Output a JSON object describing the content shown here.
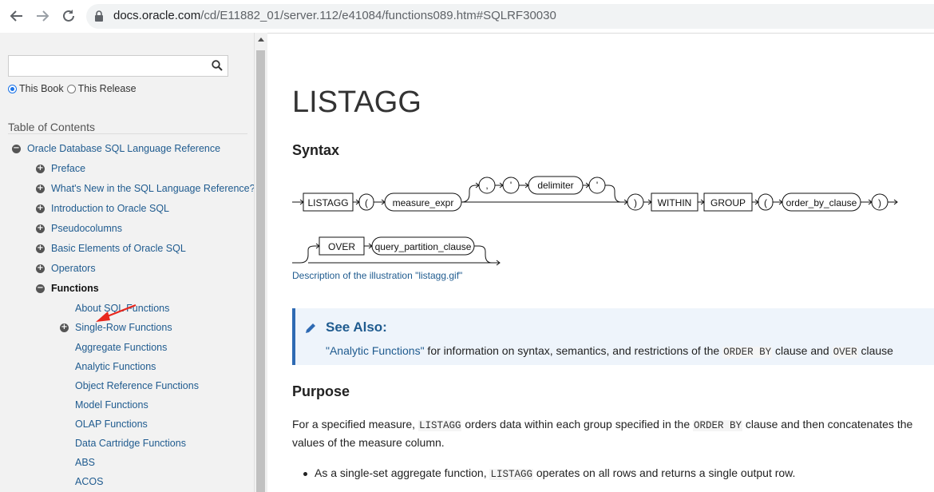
{
  "browser": {
    "url_host": "docs.oracle.com",
    "url_path": "/cd/E11882_01/server.112/e41084/functions089.htm#SQLRF30030"
  },
  "sidebar": {
    "search_placeholder": "",
    "radio_this_book": "This Book",
    "radio_this_release": "This Release",
    "toc_title": "Table of Contents",
    "items": [
      {
        "label": "Oracle Database SQL Language Reference",
        "toggle": "−"
      },
      {
        "label": "Preface",
        "toggle": "+"
      },
      {
        "label": "What's New in the SQL Language Reference?",
        "toggle": "+"
      },
      {
        "label": "Introduction to Oracle SQL",
        "toggle": "+"
      },
      {
        "label": "Pseudocolumns",
        "toggle": "+"
      },
      {
        "label": "Basic Elements of Oracle SQL",
        "toggle": "+"
      },
      {
        "label": "Operators",
        "toggle": "+"
      },
      {
        "label": "Functions",
        "toggle": "−"
      },
      {
        "label": "About SQL Functions"
      },
      {
        "label": "Single-Row Functions",
        "toggle": "+"
      },
      {
        "label": "Aggregate Functions"
      },
      {
        "label": "Analytic Functions"
      },
      {
        "label": "Object Reference Functions"
      },
      {
        "label": "Model Functions"
      },
      {
        "label": "OLAP Functions"
      },
      {
        "label": "Data Cartridge Functions"
      },
      {
        "label": "ABS"
      },
      {
        "label": "ACOS"
      }
    ]
  },
  "main": {
    "title": "LISTAGG",
    "syntax_heading": "Syntax",
    "diagram": {
      "listagg": "LISTAGG",
      "paren_open": "(",
      "measure_expr": "measure_expr",
      "comma": ",",
      "quote": "'",
      "delimiter": "delimiter",
      "paren_close": ")",
      "within": "WITHIN",
      "group": "GROUP",
      "order_by_clause": "order_by_clause",
      "over": "OVER",
      "query_partition_clause": "query_partition_clause"
    },
    "description_link": "Description of the illustration \"listagg.gif\"",
    "see_also": {
      "title": "See Also:",
      "link": "\"Analytic Functions\"",
      "text1": " for information on syntax, semantics, and restrictions of the ",
      "code1": "ORDER BY",
      "text2": " clause and ",
      "code2": "OVER",
      "text3": " clause"
    },
    "purpose_heading": "Purpose",
    "purpose": {
      "t1": "For a specified measure, ",
      "c1": "LISTAGG",
      "t2": " orders data within each group specified in the ",
      "c2": "ORDER BY",
      "t3": " clause and then concatenates the values of the measure column."
    },
    "bullet1": {
      "t1": "As a single-set aggregate function, ",
      "c1": "LISTAGG",
      "t2": " operates on all rows and returns a single output row."
    }
  },
  "colors": {
    "link": "#1f5b8f",
    "callout_border": "#2e6ab3",
    "arrow": "#e8281e"
  }
}
